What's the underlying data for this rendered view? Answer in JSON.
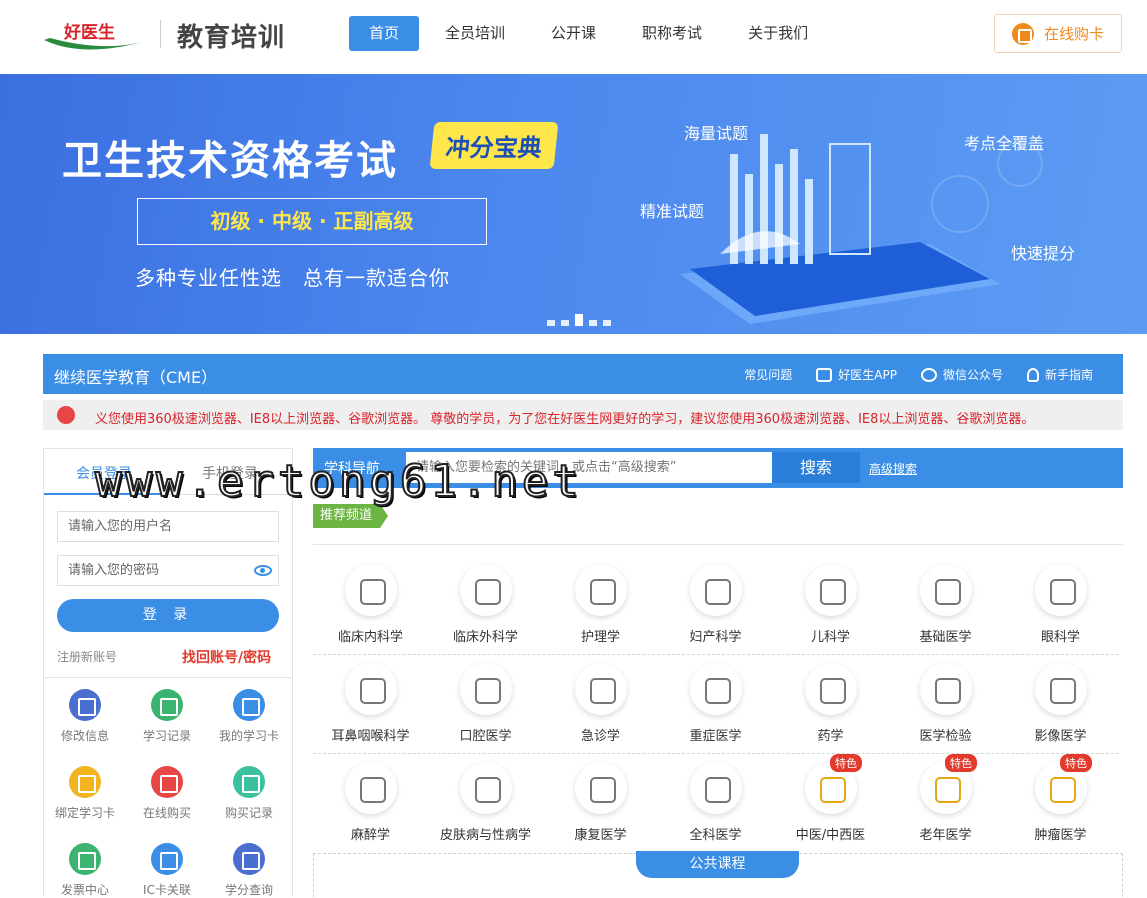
{
  "header": {
    "logo_text": "好医生",
    "site_title": "教育培训",
    "nav": [
      {
        "label": "首页",
        "active": true
      },
      {
        "label": "全员培训",
        "active": false
      },
      {
        "label": "公开课",
        "active": false
      },
      {
        "label": "职称考试",
        "active": false
      },
      {
        "label": "关于我们",
        "active": false
      }
    ],
    "buy_label": "在线购卡"
  },
  "banner": {
    "title": "卫生技术资格考试",
    "tag": "冲分宝典",
    "levels": "初级 · 中级 · 正副高级",
    "subtitle": "多种专业任性选　总有一款适合你",
    "features": [
      "海量试题",
      "考点全覆盖",
      "精准试题",
      "快速提分"
    ],
    "slide_count": 5,
    "active_slide": 3
  },
  "cme": {
    "title": "继续医学教育（CME）",
    "links": [
      "常见问题",
      "好医生APP",
      "微信公众号",
      "新手指南"
    ]
  },
  "notice": {
    "text": "义您使用360极速浏览器、IE8以上浏览器、谷歌浏览器。 尊敬的学员，为了您在好医生网更好的学习，建议您使用360极速浏览器、IE8以上浏览器、谷歌浏览器。"
  },
  "login": {
    "tab_member": "会员登录",
    "tab_phone": "手机登录",
    "username_placeholder": "请输入您的用户名",
    "password_placeholder": "请输入您的密码",
    "login_label": "登 录",
    "register_label": "注册新账号",
    "find_label": "找回账号/密码",
    "quick": [
      {
        "label": "修改信息",
        "color": "#4a6fd0"
      },
      {
        "label": "学习记录",
        "color": "#3cb371"
      },
      {
        "label": "我的学习卡",
        "color": "#3a8ee6"
      },
      {
        "label": "绑定学习卡",
        "color": "#f3b51f"
      },
      {
        "label": "在线购买",
        "color": "#e84545"
      },
      {
        "label": "购买记录",
        "color": "#3cc19e"
      },
      {
        "label": "发票中心",
        "color": "#3cb371"
      },
      {
        "label": "IC卡关联",
        "color": "#3a8ee6"
      },
      {
        "label": "学分查询",
        "color": "#4a6fd0"
      }
    ]
  },
  "courses": {
    "search_label": "学科导航",
    "search_placeholder": "请输入您要检索的关键词，或点击“高级搜索”",
    "search_button": "搜索",
    "advanced_label": "高级搜索",
    "recommended_label": "推荐频道",
    "subjects": [
      {
        "name": "临床内科学",
        "icon": "lungs-icon"
      },
      {
        "name": "临床外科学",
        "icon": "scalpel-icon"
      },
      {
        "name": "护理学",
        "icon": "medical-cross-icon"
      },
      {
        "name": "妇产科学",
        "icon": "pregnancy-icon"
      },
      {
        "name": "儿科学",
        "icon": "baby-icon"
      },
      {
        "name": "基础医学",
        "icon": "stethoscope-icon"
      },
      {
        "name": "眼科学",
        "icon": "eye-icon"
      },
      {
        "name": "耳鼻咽喉科学",
        "icon": "ear-icon"
      },
      {
        "name": "口腔医学",
        "icon": "mouth-icon"
      },
      {
        "name": "急诊学",
        "icon": "emergency-icon"
      },
      {
        "name": "重症医学",
        "icon": "monitor-icon"
      },
      {
        "name": "药学",
        "icon": "pill-icon"
      },
      {
        "name": "医学检验",
        "icon": "flask-icon"
      },
      {
        "name": "影像医学",
        "icon": "scanner-icon"
      },
      {
        "name": "麻醉学",
        "icon": "syringe-icon"
      },
      {
        "name": "皮肤病与性病学",
        "icon": "skin-icon"
      },
      {
        "name": "康复医学",
        "icon": "rehab-icon"
      },
      {
        "name": "全科医学",
        "icon": "medkit-icon"
      },
      {
        "name": "中医/中西医",
        "icon": "mortar-icon",
        "badge": "特色"
      },
      {
        "name": "老年医学",
        "icon": "elderly-icon",
        "badge": "特色"
      },
      {
        "name": "肿瘤医学",
        "icon": "virus-icon",
        "badge": "特色"
      }
    ],
    "public_label": "公共课程"
  },
  "watermark": "www.ertong61.net"
}
